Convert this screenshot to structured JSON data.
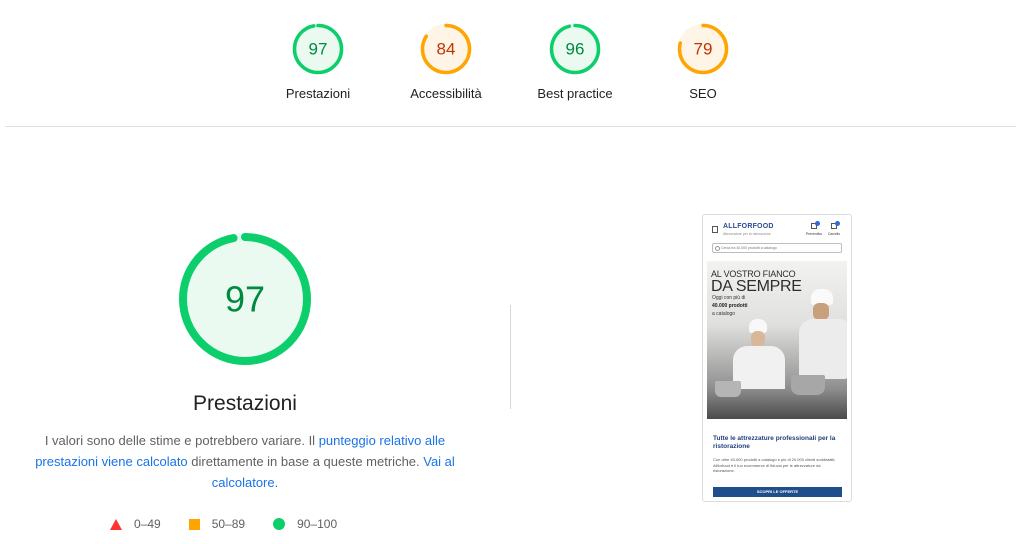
{
  "categories": [
    {
      "label": "Prestazioni",
      "score": "97",
      "value": 0.97,
      "color": "#0cce6b",
      "fill": "#eafaf1",
      "text_color": "#008a41"
    },
    {
      "label": "Accessibilità",
      "score": "84",
      "value": 0.84,
      "color": "#ffa400",
      "fill": "#fff5e6",
      "text_color": "#c33300"
    },
    {
      "label": "Best practice",
      "score": "96",
      "value": 0.96,
      "color": "#0cce6b",
      "fill": "#eafaf1",
      "text_color": "#008a41"
    },
    {
      "label": "SEO",
      "score": "79",
      "value": 0.79,
      "color": "#ffa400",
      "fill": "#fff5e6",
      "text_color": "#c33300"
    }
  ],
  "main": {
    "score": "97",
    "value": 0.97,
    "title": "Prestazioni",
    "desc_part1": "I valori sono delle stime e potrebbero variare. Il ",
    "desc_link1": "punteggio relativo alle prestazioni viene calcolato",
    "desc_part2": " direttamente in base a queste metriche. ",
    "desc_link2": "Vai al calcolatore.",
    "desc_end": ""
  },
  "legend": {
    "fail": "0–49",
    "average": "50–89",
    "pass": "90–100"
  },
  "screenshot": {
    "logo": "ALLFORFOOD",
    "logo_sub": "Attrezzature per la ristorazione",
    "icon1": "Preventivo",
    "icon2": "Carrello",
    "search_placeholder": "Cerca tra 40.000 prodotti a catalogo",
    "hero_line1": "AL VOSTRO FIANCO",
    "hero_line2": "DA SEMPRE",
    "hero_sub1": "Oggi con più di",
    "hero_sub2": "40.000 prodotti",
    "hero_sub3": "a catalogo",
    "heading": "Tutte le attrezzature professionali per la ristorazione",
    "paragraph": "Con oltre 40.000 prodotti a catalogo e più di 20.000 clienti soddisfatti, Allforfood è il tuo ecommerce di fiducia per le attrezzature da ristorazione.",
    "button": "SCOPRI LE OFFERTE"
  }
}
